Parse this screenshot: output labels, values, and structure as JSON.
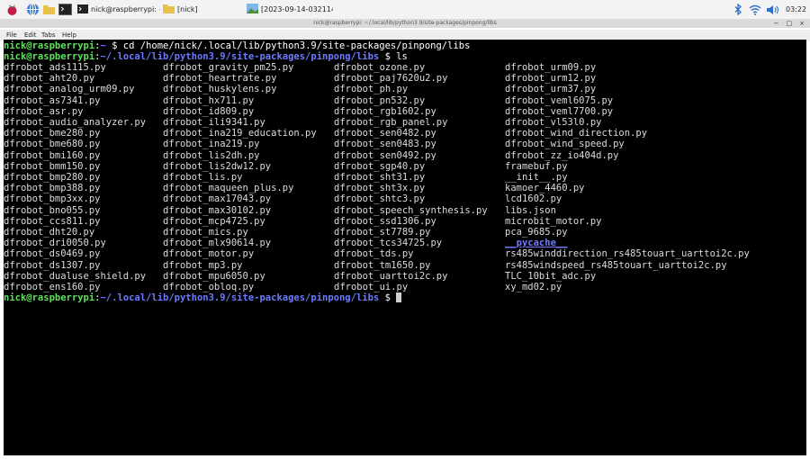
{
  "taskbar": {
    "window_buttons": [
      {
        "label": "nick@raspberrypi: ~/..."
      },
      {
        "label": "[nick]"
      },
      {
        "label": "[2023-09-14-032114..."
      }
    ],
    "clock": "03:22"
  },
  "window": {
    "title": "nick@raspberrypi: ~/.local/lib/python3.9/site-packages/pinpong/libs"
  },
  "menu": [
    "File",
    "Edit",
    "Tabs",
    "Help"
  ],
  "terminal": {
    "user_host": "nick@raspberrypi",
    "cmd1_path": "~",
    "cmd1_command": "cd /home/nick/.local/lib/python3.9/site-packages/pinpong/libs",
    "cmd2_path": "~/.local/lib/python3.9/site-packages/pinpong/libs",
    "cmd2_command": "ls",
    "prompt_symbol": "$",
    "columns": [
      [
        "dfrobot_ads1115.py",
        "dfrobot_aht20.py",
        "dfrobot_analog_urm09.py",
        "dfrobot_as7341.py",
        "dfrobot_asr.py",
        "dfrobot_audio_analyzer.py",
        "dfrobot_bme280.py",
        "dfrobot_bme680.py",
        "dfrobot_bmi160.py",
        "dfrobot_bmm150.py",
        "dfrobot_bmp280.py",
        "dfrobot_bmp388.py",
        "dfrobot_bmp3xx.py",
        "dfrobot_bno055.py",
        "dfrobot_ccs811.py",
        "dfrobot_dht20.py",
        "dfrobot_dri0050.py",
        "dfrobot_ds0469.py",
        "dfrobot_ds1307.py",
        "dfrobot_dualuse_shield.py",
        "dfrobot_ens160.py"
      ],
      [
        "dfrobot_gravity_pm25.py",
        "dfrobot_heartrate.py",
        "dfrobot_huskylens.py",
        "dfrobot_hx711.py",
        "dfrobot_id809.py",
        "dfrobot_ili9341.py",
        "dfrobot_ina219_education.py",
        "dfrobot_ina219.py",
        "dfrobot_lis2dh.py",
        "dfrobot_lis2dw12.py",
        "dfrobot_lis.py",
        "dfrobot_maqueen_plus.py",
        "dfrobot_max17043.py",
        "dfrobot_max30102.py",
        "dfrobot_mcp4725.py",
        "dfrobot_mics.py",
        "dfrobot_mlx90614.py",
        "dfrobot_motor.py",
        "dfrobot_mp3.py",
        "dfrobot_mpu6050.py",
        "dfrobot_obloq.py"
      ],
      [
        "dfrobot_ozone.py",
        "dfrobot_paj7620u2.py",
        "dfrobot_ph.py",
        "dfrobot_pn532.py",
        "dfrobot_rgb1602.py",
        "dfrobot_rgb_panel.py",
        "dfrobot_sen0482.py",
        "dfrobot_sen0483.py",
        "dfrobot_sen0492.py",
        "dfrobot_sgp40.py",
        "dfrobot_sht31.py",
        "dfrobot_sht3x.py",
        "dfrobot_shtc3.py",
        "dfrobot_speech_synthesis.py",
        "dfrobot_ssd1306.py",
        "dfrobot_st7789.py",
        "dfrobot_tcs34725.py",
        "dfrobot_tds.py",
        "dfrobot_tm1650.py",
        "dfrobot_uarttoi2c.py",
        "dfrobot_ui.py"
      ],
      [
        "dfrobot_urm09.py",
        "dfrobot_urm12.py",
        "dfrobot_urm37.py",
        "dfrobot_veml6075.py",
        "dfrobot_veml7700.py",
        "dfrobot_vl53l0.py",
        "dfrobot_wind_direction.py",
        "dfrobot_wind_speed.py",
        "dfrobot_zz_io404d.py",
        "framebuf.py",
        "__init__.py",
        "kamoer_4460.py",
        "lcd1602.py",
        "libs.json",
        "microbit_motor.py",
        "pca_9685.py",
        "__pycache__",
        "rs485winddirection_rs485touart_uarttoi2c.py",
        "rs485windspeed_rs485touart_uarttoi2c.py",
        "TLC_10bit_adc.py",
        "xy_md02.py"
      ]
    ],
    "directory_entries": [
      "__pycache__"
    ],
    "colors": {
      "user": "#5fe05f",
      "path": "#6c7bff",
      "text": "#dcdcdc",
      "background": "#000000"
    }
  }
}
